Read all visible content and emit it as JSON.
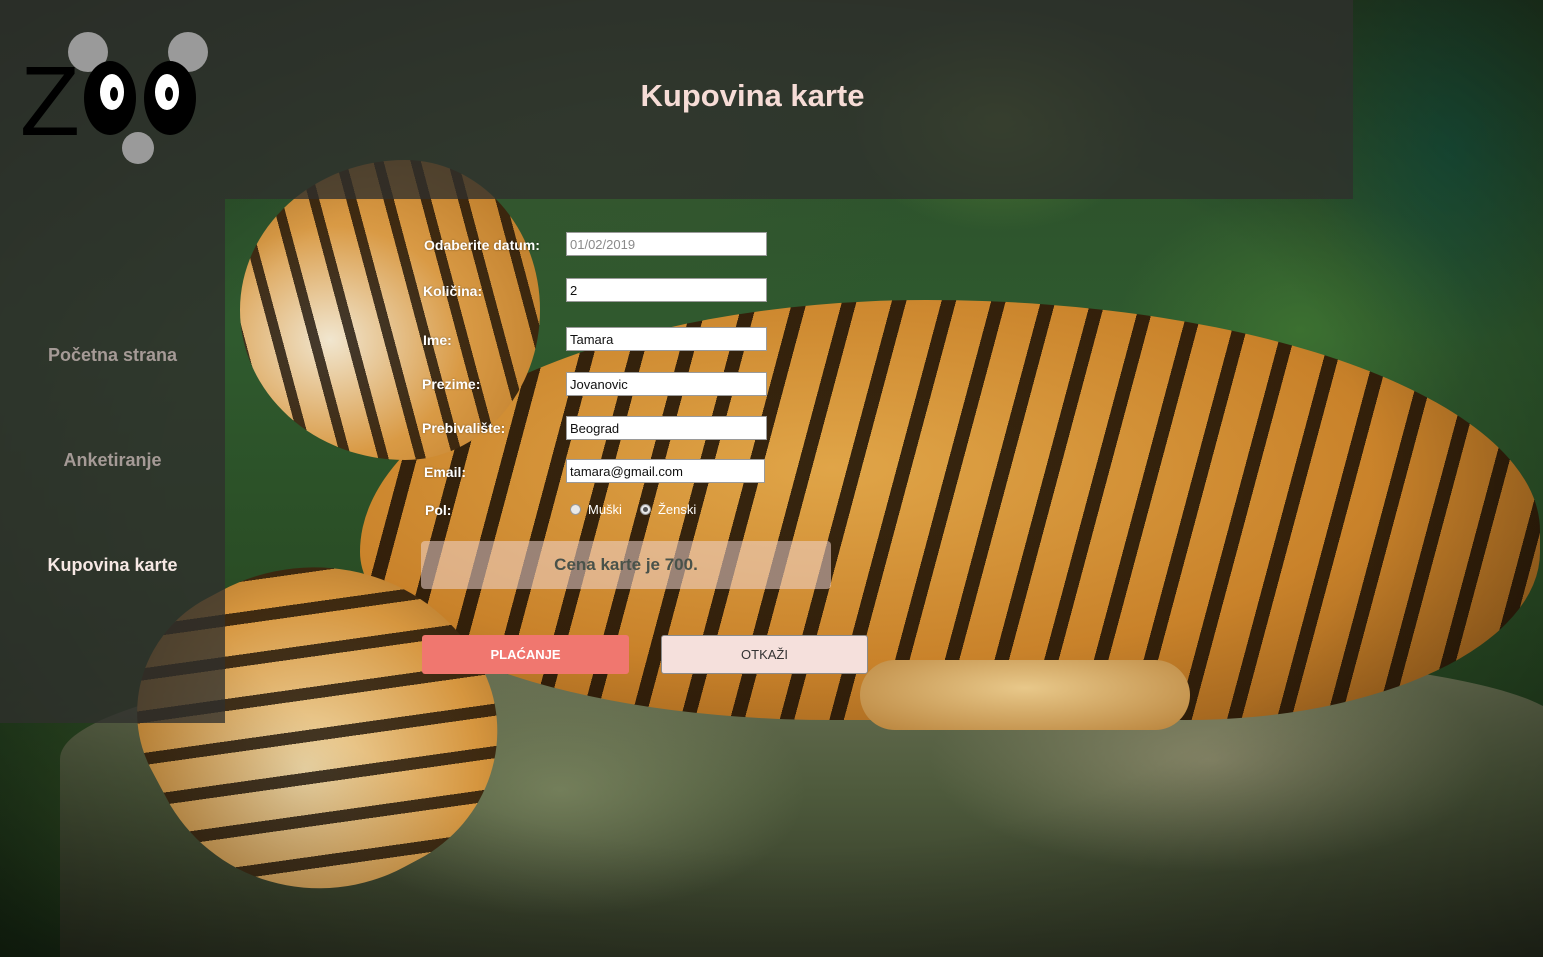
{
  "header": {
    "logo_text": "ZOO",
    "title": "Kupovina karte"
  },
  "sidebar": {
    "items": [
      {
        "label": "Početna strana",
        "active": false
      },
      {
        "label": "Anketiranje",
        "active": false
      },
      {
        "label": "Kupovina karte",
        "active": true
      }
    ]
  },
  "form": {
    "date": {
      "label": "Odaberite datum:",
      "value": "01/02/2019"
    },
    "quantity": {
      "label": "Količina:",
      "value": "2"
    },
    "first_name": {
      "label": "Ime:",
      "value": "Tamara"
    },
    "last_name": {
      "label": "Prezime:",
      "value": "Jovanovic"
    },
    "residence": {
      "label": "Prebivalište:",
      "value": "Beograd"
    },
    "email": {
      "label": "Email:",
      "value": "tamara@gmail.com"
    },
    "gender": {
      "label": "Pol:",
      "options": [
        {
          "label": "Muški",
          "checked": false
        },
        {
          "label": "Ženski",
          "checked": true
        }
      ]
    }
  },
  "price_text": "Cena karte je 700.",
  "buttons": {
    "pay": "PLAĆANJE",
    "cancel": "OTKAŽI"
  },
  "colors": {
    "overlay": "#30302d",
    "title": "#f6dcd6",
    "pay_button": "#f0776f",
    "cancel_button": "#f5e0dc"
  }
}
